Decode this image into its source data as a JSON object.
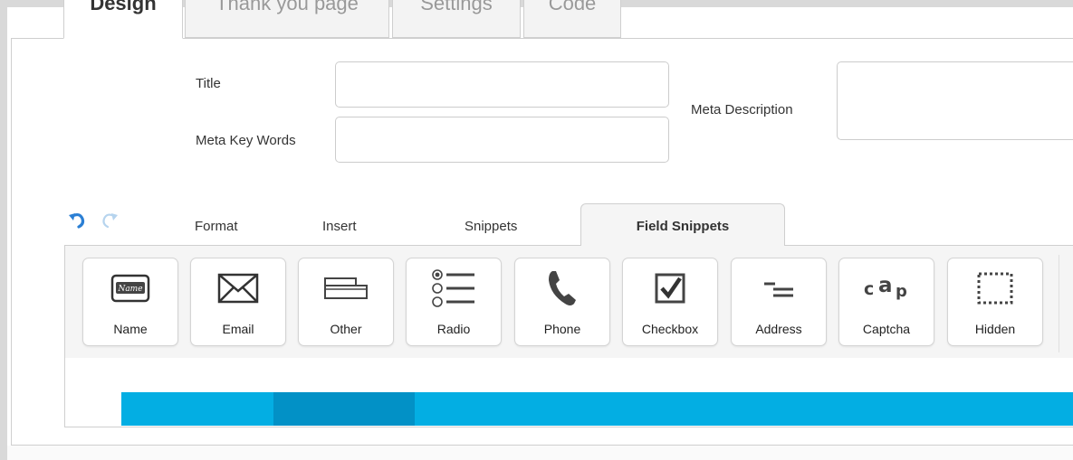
{
  "top_tabs": [
    {
      "label": "Design",
      "active": true
    },
    {
      "label": "Thank you page",
      "active": false
    },
    {
      "label": "Settings",
      "active": false
    },
    {
      "label": "Code",
      "active": false
    }
  ],
  "meta": {
    "title_label": "Title",
    "title_value": "",
    "keywords_label": "Meta Key Words",
    "keywords_value": "",
    "description_label": "Meta Description",
    "description_value": ""
  },
  "editor_tabs": {
    "format": "Format",
    "insert": "Insert",
    "snippets": "Snippets",
    "field_snippets": "Field Snippets"
  },
  "field_buttons": [
    {
      "label": "Name",
      "icon": "name-tag-icon"
    },
    {
      "label": "Email",
      "icon": "envelope-icon"
    },
    {
      "label": "Other",
      "icon": "other-field-icon"
    },
    {
      "label": "Radio",
      "icon": "radio-list-icon"
    },
    {
      "label": "Phone",
      "icon": "phone-icon"
    },
    {
      "label": "Checkbox",
      "icon": "checkbox-icon"
    },
    {
      "label": "Address",
      "icon": "address-lines-icon"
    },
    {
      "label": "Captcha",
      "icon": "captcha-icon"
    },
    {
      "label": "Hidden",
      "icon": "hidden-dotted-box-icon"
    }
  ],
  "colors": {
    "accent_blue": "#03aee3",
    "accent_blue_dark": "#0291c6",
    "undo_blue": "#2b7fd4",
    "redo_disabled": "#b6d4ee"
  },
  "icons": {
    "undo": "undo-icon",
    "redo": "redo-icon"
  }
}
